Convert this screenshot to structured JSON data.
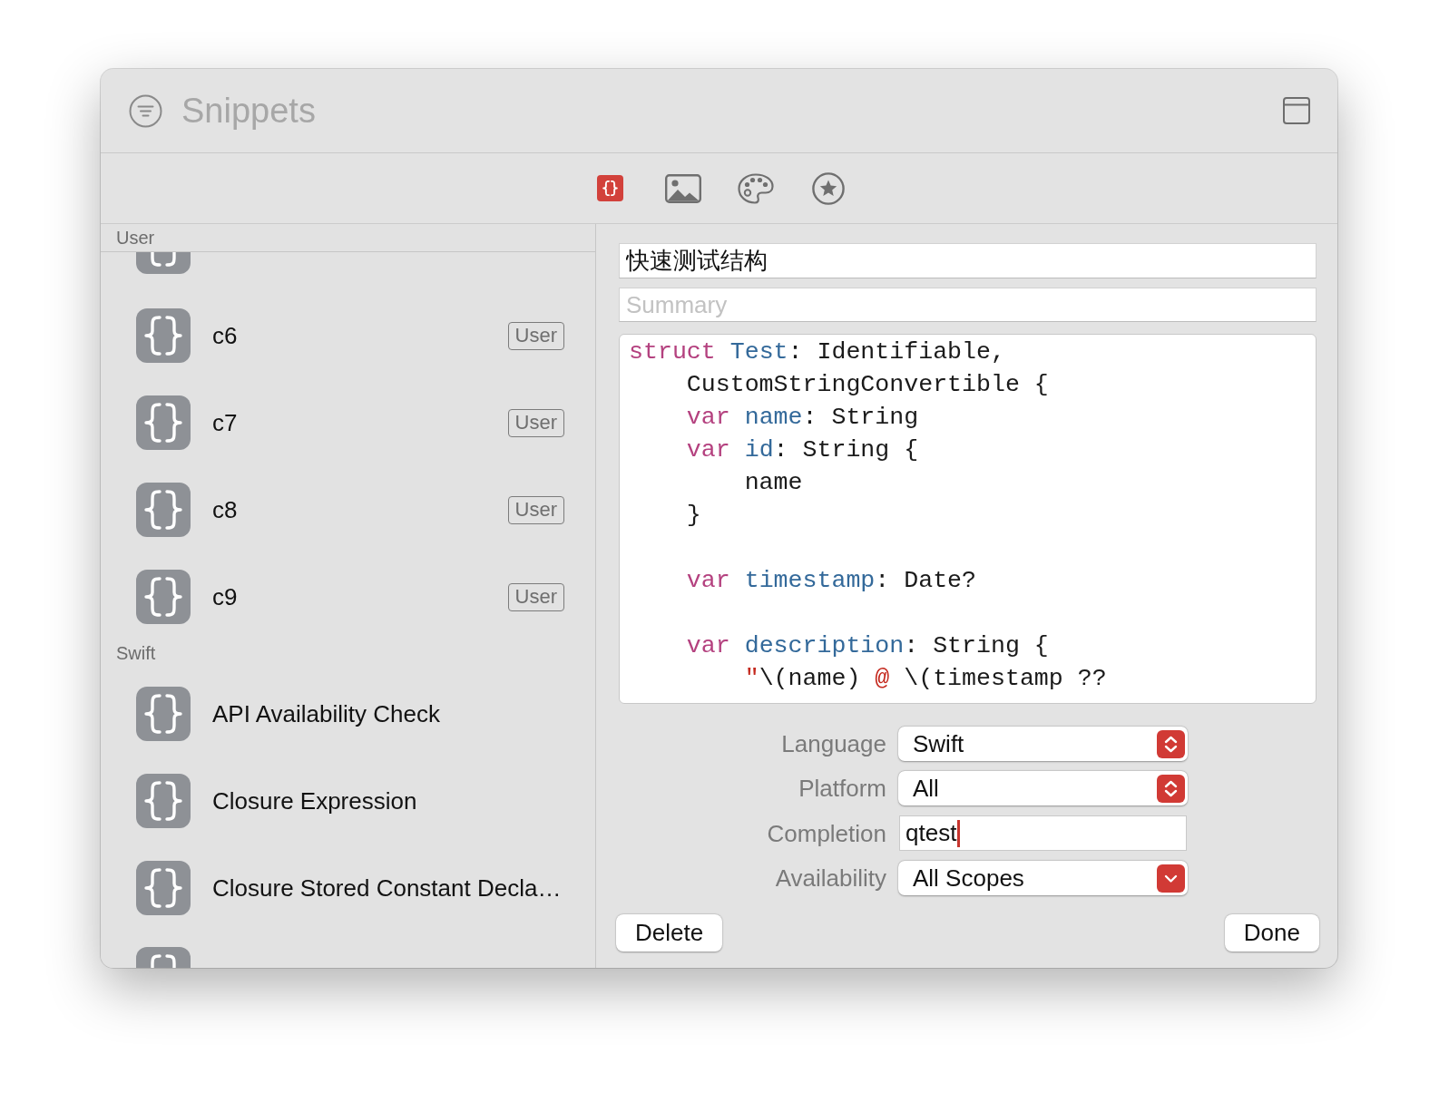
{
  "window": {
    "title": "Snippets"
  },
  "toolbar": {
    "tabs": [
      {
        "kind": "code",
        "selected": true
      },
      {
        "kind": "image",
        "selected": false
      },
      {
        "kind": "palette",
        "selected": false
      },
      {
        "kind": "star",
        "selected": false
      }
    ]
  },
  "sidebar": {
    "sections": [
      {
        "title": "User",
        "items": [
          {
            "kind": "cut-top"
          },
          {
            "kind": "row",
            "name": "c6",
            "badge": "User"
          },
          {
            "kind": "row",
            "name": "c7",
            "badge": "User"
          },
          {
            "kind": "row",
            "name": "c8",
            "badge": "User"
          },
          {
            "kind": "row",
            "name": "c9",
            "badge": "User"
          }
        ]
      },
      {
        "title": "Swift",
        "items": [
          {
            "kind": "row",
            "name": "API Availability Check"
          },
          {
            "kind": "row",
            "name": "Closure Expression"
          },
          {
            "kind": "row",
            "name": "Closure Stored Constant Decla…"
          },
          {
            "kind": "cut-bottom"
          }
        ]
      }
    ]
  },
  "editor": {
    "title_field": {
      "value": "快速测试结构"
    },
    "summary_field": {
      "placeholder": "Summary"
    },
    "code": {
      "lines": [
        {
          "kind": "code",
          "segments": [
            {
              "kind": "keyword",
              "text": "struct "
            },
            {
              "kind": "decl",
              "text": "Test"
            },
            {
              "kind": "plain",
              "text": ": Identifiable,"
            }
          ]
        },
        {
          "kind": "code",
          "segments": [
            {
              "kind": "plain",
              "text": "    CustomStringConvertible {"
            }
          ]
        },
        {
          "kind": "code",
          "segments": [
            {
              "kind": "keyword",
              "text": "    var "
            },
            {
              "kind": "decl",
              "text": "name"
            },
            {
              "kind": "plain",
              "text": ": String"
            }
          ]
        },
        {
          "kind": "code",
          "segments": [
            {
              "kind": "keyword",
              "text": "    var "
            },
            {
              "kind": "decl",
              "text": "id"
            },
            {
              "kind": "plain",
              "text": ": String {"
            }
          ]
        },
        {
          "kind": "code",
          "segments": [
            {
              "kind": "plain",
              "text": "        name"
            }
          ]
        },
        {
          "kind": "code",
          "segments": [
            {
              "kind": "plain",
              "text": "    }"
            }
          ]
        },
        {
          "kind": "blank"
        },
        {
          "kind": "code",
          "segments": [
            {
              "kind": "keyword",
              "text": "    var "
            },
            {
              "kind": "decl",
              "text": "timestamp"
            },
            {
              "kind": "plain",
              "text": ": Date?"
            }
          ]
        },
        {
          "kind": "blank"
        },
        {
          "kind": "code",
          "segments": [
            {
              "kind": "keyword",
              "text": "    var "
            },
            {
              "kind": "decl",
              "text": "description"
            },
            {
              "kind": "plain",
              "text": ": String {"
            }
          ]
        },
        {
          "kind": "code",
          "segments": [
            {
              "kind": "string",
              "text": "        \""
            },
            {
              "kind": "plain",
              "text": "\\(name) "
            },
            {
              "kind": "string",
              "text": "@"
            },
            {
              "kind": "plain",
              "text": " \\(timestamp ??"
            }
          ]
        }
      ]
    }
  },
  "form": {
    "fields": [
      {
        "kind": "popup",
        "label": "Language",
        "value": "Swift",
        "focused": false
      },
      {
        "kind": "popup",
        "label": "Platform",
        "value": "All",
        "focused": false
      },
      {
        "kind": "text",
        "label": "Completion",
        "value": "qtest",
        "focused": true
      },
      {
        "kind": "pulldown",
        "label": "Availability",
        "value": "All Scopes",
        "focused": false
      }
    ]
  },
  "buttons": [
    {
      "label": "Delete"
    },
    {
      "label": "Done"
    }
  ]
}
